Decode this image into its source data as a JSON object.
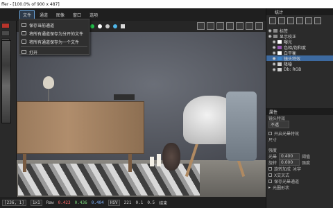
{
  "window": {
    "title": "ffer - [100.0% of 900 x 487]"
  },
  "menu": [
    "文件",
    "通道",
    "图像",
    "窗口",
    "选项"
  ],
  "file_menu": {
    "items": [
      "保存当前通道",
      "将所有通道保存为分开的文件",
      "将所有通道保存为一个文件",
      "打开"
    ]
  },
  "toolbar": {
    "colors": [
      "#21c24b",
      "#ffffff",
      "#c8c8c8",
      "#4fb6e8"
    ]
  },
  "statusbar": {
    "coords": "[236, 1]",
    "zoom": "1x1",
    "raw_label": "Raw",
    "r": "0.423",
    "g": "0.436",
    "b": "0.404",
    "hsv_label": "HSV",
    "h": "221",
    "s": "0.1",
    "v": "0.5",
    "finish": "结束"
  },
  "right_panel": {
    "title": "统计",
    "layers": [
      {
        "label": "标签",
        "color": "#8a8a8a"
      },
      {
        "label": "显示校正",
        "color": "#8a8a8a"
      },
      {
        "label": "曝光",
        "color": "#ffffff"
      },
      {
        "label": "色相/饱和度",
        "color": "#9b59b6"
      },
      {
        "label": "白平衡",
        "color": "#ffffff"
      },
      {
        "label": "镜头特效",
        "color": "#3b84c9",
        "selected": true
      },
      {
        "label": "降噪",
        "color": "#cfcfcf"
      },
      {
        "label": "Db: RGB",
        "color": "#cfcfcf"
      }
    ],
    "properties": {
      "header": "属性",
      "effect_label": "镜头特效",
      "mode": "不透",
      "bloom_label": "开启光晕特效",
      "size_label": "尺寸",
      "gain_label": "强度",
      "light_label": "光晕",
      "light_value": "0.400",
      "threshold_label": "阈值",
      "rotate_label": "旋转",
      "rotate_value": "0.000",
      "fill_label": "强度",
      "spin_label": "旋转加成",
      "spin_right": "冰宇",
      "cross_label": "X交叉式",
      "save_label": "保存光晕通道",
      "shape_label": "光圈形状"
    }
  }
}
